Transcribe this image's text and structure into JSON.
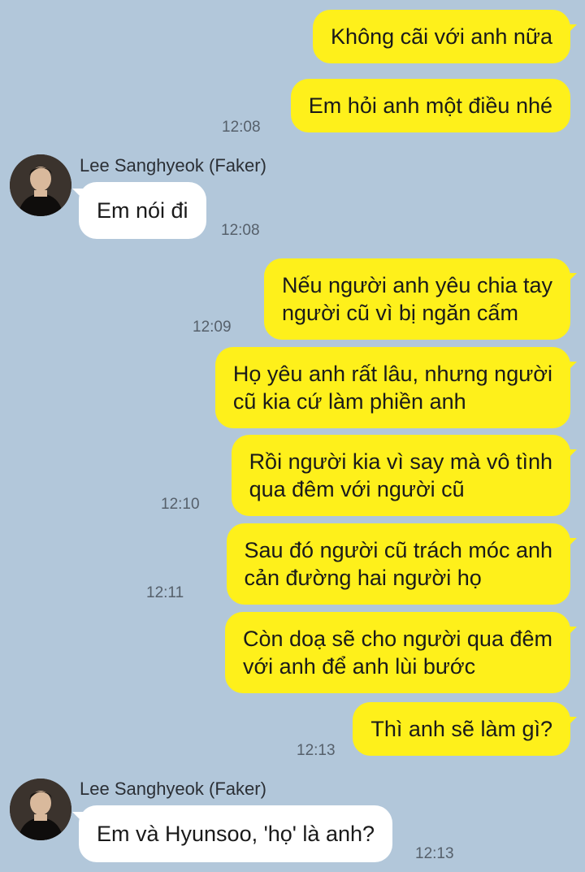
{
  "contact": {
    "name": "Lee Sanghyeok (Faker)"
  },
  "messages": {
    "m1": "Không cãi với anh nữa",
    "m2": "Em hỏi anh một điều nhé",
    "t1": "12:08",
    "m3": "Em nói đi",
    "t2": "12:08",
    "m4": "Nếu người anh yêu chia tay\nngười cũ vì bị ngăn cấm",
    "t3": "12:09",
    "m5": "Họ yêu anh rất lâu, nhưng người\ncũ kia cứ làm phiền anh",
    "m6": "Rồi người kia vì say mà vô tình\nqua đêm với người cũ",
    "t4": "12:10",
    "m7": "Sau đó người cũ trách móc anh\ncản đường hai người họ",
    "t5": "12:11",
    "m8": "Còn doạ sẽ cho người qua đêm\nvới anh để anh lùi bước",
    "m9": "Thì anh sẽ làm gì?",
    "t6": "12:13",
    "m10": "Em và Hyunsoo, 'họ' là anh?",
    "t7": "12:13"
  },
  "colors": {
    "background": "#b2c7da",
    "my_bubble": "#fef01b",
    "their_bubble": "#ffffff"
  },
  "icons": {
    "avatar": "profile-photo"
  }
}
